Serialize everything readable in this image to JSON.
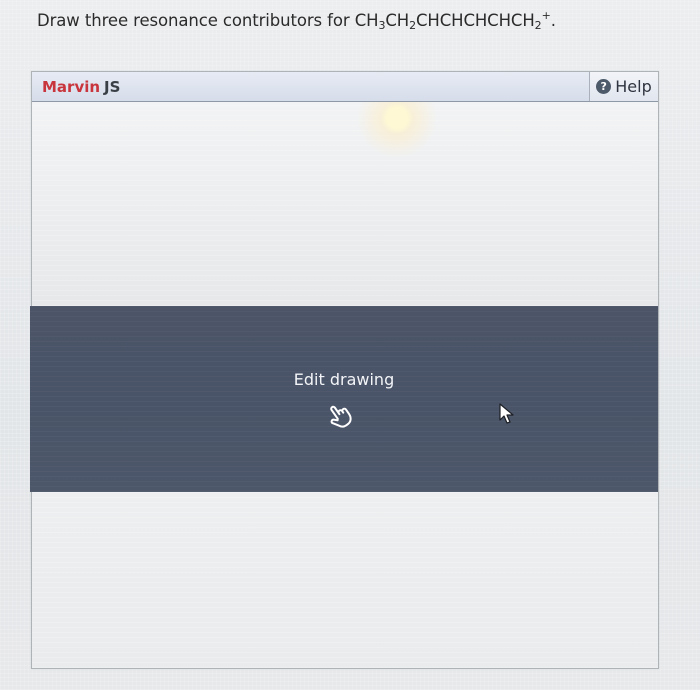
{
  "question": {
    "prefix": "Draw three resonance contributors for ",
    "formula": [
      {
        "t": "CH"
      },
      {
        "sub": "3"
      },
      {
        "t": "CH"
      },
      {
        "sub": "2"
      },
      {
        "t": "CHCHCHCHCH"
      },
      {
        "sub": "2"
      },
      {
        "sup": "+"
      },
      {
        "t": "."
      }
    ]
  },
  "editor": {
    "brand": "Marvin",
    "brand_suffix": "JS",
    "help_label": "Help",
    "help_icon": "help-icon",
    "overlay_label": "Edit drawing",
    "overlay_icon": "hand-pointer-icon"
  },
  "colors": {
    "brand": "#c9353d",
    "overlay": "#4b5567"
  }
}
